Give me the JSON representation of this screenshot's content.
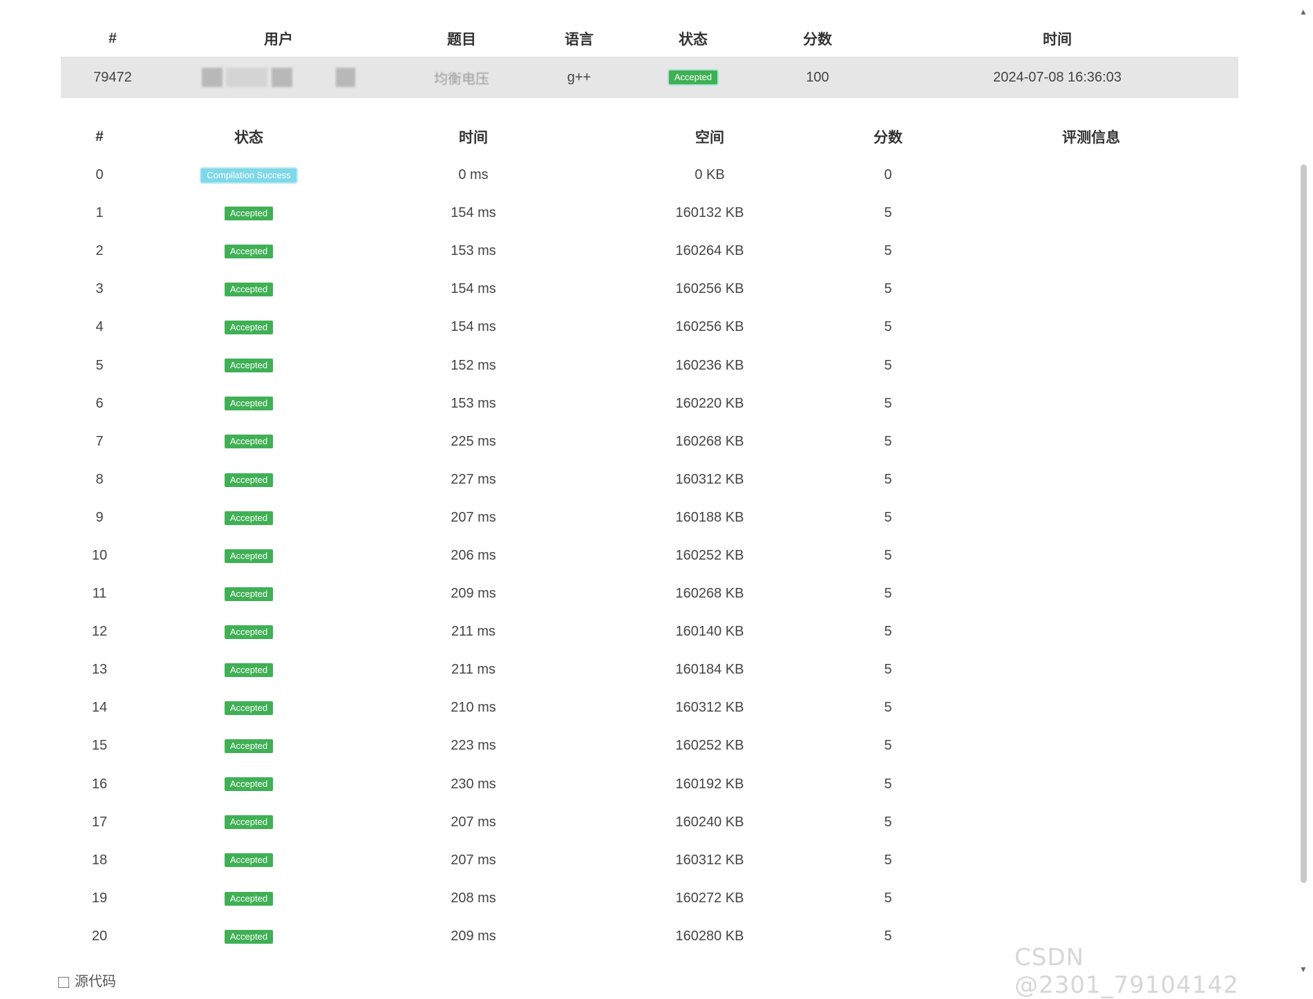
{
  "summary": {
    "headers": [
      "#",
      "用户",
      "题目",
      "语言",
      "状态",
      "分数",
      "时间"
    ],
    "row": {
      "id": "79472",
      "problem": "均衡电压",
      "language": "g++",
      "status": "Accepted",
      "score": "100",
      "time": "2024-07-08 16:36:03"
    }
  },
  "cases": {
    "headers": [
      "#",
      "状态",
      "时间",
      "空间",
      "分数",
      "评测信息"
    ],
    "rows": [
      {
        "n": "0",
        "status": "Compilation Success",
        "time": "0 ms",
        "space": "0 KB",
        "score": "0"
      },
      {
        "n": "1",
        "status": "Accepted",
        "time": "154 ms",
        "space": "160132 KB",
        "score": "5"
      },
      {
        "n": "2",
        "status": "Accepted",
        "time": "153 ms",
        "space": "160264 KB",
        "score": "5"
      },
      {
        "n": "3",
        "status": "Accepted",
        "time": "154 ms",
        "space": "160256 KB",
        "score": "5"
      },
      {
        "n": "4",
        "status": "Accepted",
        "time": "154 ms",
        "space": "160256 KB",
        "score": "5"
      },
      {
        "n": "5",
        "status": "Accepted",
        "time": "152 ms",
        "space": "160236 KB",
        "score": "5"
      },
      {
        "n": "6",
        "status": "Accepted",
        "time": "153 ms",
        "space": "160220 KB",
        "score": "5"
      },
      {
        "n": "7",
        "status": "Accepted",
        "time": "225 ms",
        "space": "160268 KB",
        "score": "5"
      },
      {
        "n": "8",
        "status": "Accepted",
        "time": "227 ms",
        "space": "160312 KB",
        "score": "5"
      },
      {
        "n": "9",
        "status": "Accepted",
        "time": "207 ms",
        "space": "160188 KB",
        "score": "5"
      },
      {
        "n": "10",
        "status": "Accepted",
        "time": "206 ms",
        "space": "160252 KB",
        "score": "5"
      },
      {
        "n": "11",
        "status": "Accepted",
        "time": "209 ms",
        "space": "160268 KB",
        "score": "5"
      },
      {
        "n": "12",
        "status": "Accepted",
        "time": "211 ms",
        "space": "160140 KB",
        "score": "5"
      },
      {
        "n": "13",
        "status": "Accepted",
        "time": "211 ms",
        "space": "160184 KB",
        "score": "5"
      },
      {
        "n": "14",
        "status": "Accepted",
        "time": "210 ms",
        "space": "160312 KB",
        "score": "5"
      },
      {
        "n": "15",
        "status": "Accepted",
        "time": "223 ms",
        "space": "160252 KB",
        "score": "5"
      },
      {
        "n": "16",
        "status": "Accepted",
        "time": "230 ms",
        "space": "160192 KB",
        "score": "5"
      },
      {
        "n": "17",
        "status": "Accepted",
        "time": "207 ms",
        "space": "160240 KB",
        "score": "5"
      },
      {
        "n": "18",
        "status": "Accepted",
        "time": "207 ms",
        "space": "160312 KB",
        "score": "5"
      },
      {
        "n": "19",
        "status": "Accepted",
        "time": "208 ms",
        "space": "160272 KB",
        "score": "5"
      },
      {
        "n": "20",
        "status": "Accepted",
        "time": "209 ms",
        "space": "160280 KB",
        "score": "5"
      }
    ]
  },
  "footer": {
    "code_label": "源代码"
  },
  "watermark": "CSDN @2301_79104142",
  "colors": {
    "accepted": "#40b055",
    "compile": "#7fd8e8",
    "summary_row": "#e6e6e6"
  }
}
